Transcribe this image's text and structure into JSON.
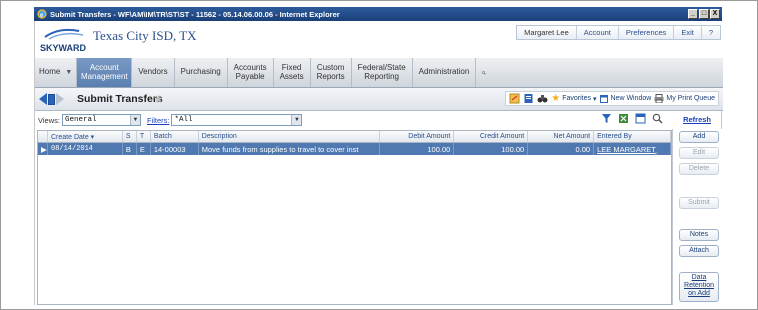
{
  "window": {
    "title": "Submit Transfers - WF\\AM\\IM\\TR\\ST\\ST - 11562 - 05.14.06.00.06 - Internet Explorer",
    "buttons": [
      "_",
      "□",
      "X"
    ]
  },
  "header": {
    "logo_text": "SKYWARD",
    "district": "Texas City ISD, TX",
    "user_links": [
      "Margaret Lee",
      "Account",
      "Preferences",
      "Exit",
      "?"
    ]
  },
  "nav": {
    "home": "Home",
    "items": [
      {
        "label": "Account\nManagement",
        "active": true
      },
      {
        "label": "Vendors"
      },
      {
        "label": "Purchasing"
      },
      {
        "label": "Accounts\nPayable"
      },
      {
        "label": "Fixed\nAssets"
      },
      {
        "label": "Custom\nReports"
      },
      {
        "label": "Federal/State\nReporting"
      },
      {
        "label": "Administration"
      }
    ]
  },
  "toolbar": {
    "title": "Submit Transfers",
    "favorites": "Favorites",
    "new_window": "New Window",
    "print_queue": "My Print Queue"
  },
  "filter": {
    "views_label": "Views:",
    "views_value": "General",
    "filters_label": "Filters:",
    "filters_value": "*All",
    "refresh": "Refresh"
  },
  "grid": {
    "columns": [
      "",
      "Create Date ▾",
      "S",
      "T",
      "Batch",
      "Description",
      "Debit Amount",
      "Credit Amount",
      "Net Amount",
      "Entered By"
    ],
    "rows": [
      {
        "marker": "▶",
        "create_date": "08/14/2014",
        "s": "B",
        "t": "E",
        "batch": "14-00003",
        "description": "Move funds from supplies to travel to cover inst",
        "debit": "100.00",
        "credit": "100.00",
        "net": "0.00",
        "entered_by": "LEE MARGARET"
      }
    ]
  },
  "side_buttons": {
    "add": "Add",
    "edit": "Edit",
    "delete": "Delete",
    "submit": "Submit",
    "notes": "Notes",
    "attach": "Attach",
    "data_retention": "Data\nRetention\non Add"
  },
  "colors": {
    "titlebar": "#1a3f78",
    "active_nav": "#5a7fb1",
    "selected_row": "#4f79b0",
    "link": "#1a3fbf"
  }
}
